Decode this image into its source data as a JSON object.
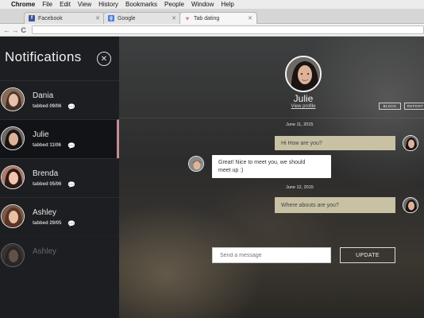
{
  "menubar": {
    "apple": "",
    "items": [
      "Chrome",
      "File",
      "Edit",
      "View",
      "History",
      "Bookmarks",
      "People",
      "Window",
      "Help"
    ]
  },
  "tabs": [
    {
      "label": "Facebook",
      "icon": "facebook-icon",
      "color": "#3b5998"
    },
    {
      "label": "Google",
      "icon": "google-icon",
      "color": "#4a7de0"
    },
    {
      "label": "Tab dating",
      "icon": "heart-icon",
      "color": "#d9889b"
    }
  ],
  "toolbar": {
    "back": "←",
    "forward": "→",
    "reload": "C",
    "address": ""
  },
  "sidebar": {
    "title": "Notifications",
    "close_icon": "✕",
    "contacts": [
      {
        "name": "Dania",
        "tabbed": "tabbed 09/06",
        "chat_icon": "speech-bubble-icon"
      },
      {
        "name": "Julie",
        "tabbed": "tabbed 11/06",
        "chat_icon": "speech-bubble-icon"
      },
      {
        "name": "Brenda",
        "tabbed": "tabbed 05/06",
        "chat_icon": "speech-bubble-icon"
      },
      {
        "name": "Ashley",
        "tabbed": "tabbed 29/05",
        "chat_icon": "speech-bubble-icon"
      },
      {
        "name": "Ashley",
        "tabbed": "",
        "chat_icon": ""
      }
    ],
    "active_color": "#c48b97"
  },
  "profile": {
    "name": "Julie",
    "view_profile": "View profile",
    "block": "BLOCK",
    "report": "REPORT"
  },
  "messages": [
    {
      "date": "June 11, 2015"
    },
    {
      "text": "Hi How are you?",
      "direction": "out"
    },
    {
      "text_line1": "Great! Nice to meet you, we should",
      "text_line2": "meet up :)",
      "direction": "in"
    },
    {
      "date": "June 12, 2015"
    },
    {
      "text": "Where abouts are you?",
      "direction": "out"
    }
  ],
  "composer": {
    "placeholder": "Send a message",
    "button": "UPDATE"
  },
  "colors": {
    "sidebar_bg": "#1d1e22",
    "outgoing_bubble": "#c8c1a4",
    "incoming_bubble": "#ffffff"
  }
}
